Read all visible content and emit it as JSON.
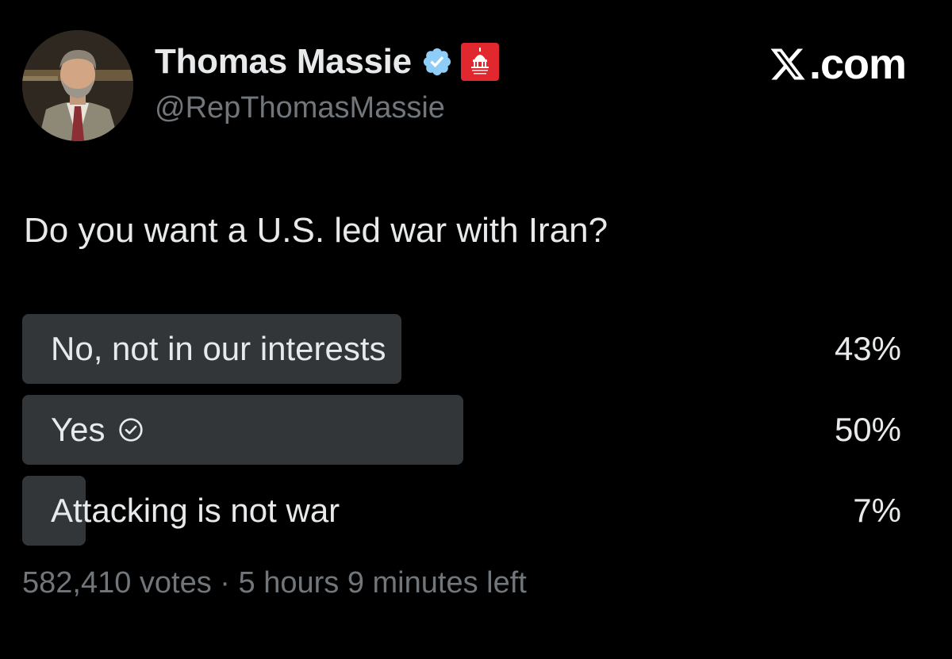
{
  "author": {
    "display_name": "Thomas Massie",
    "handle": "@RepThomasMassie",
    "verified": true,
    "affiliation_badge": "house-gop-capitol-icon"
  },
  "site_brand": ".com",
  "post": {
    "text": "Do you want a U.S. led war with Iran?"
  },
  "poll": {
    "options": [
      {
        "label": "No, not in our interests",
        "percent_label": "43%",
        "percent": 43,
        "selected": false
      },
      {
        "label": "Yes",
        "percent_label": "50%",
        "percent": 50,
        "selected": true
      },
      {
        "label": "Attacking is not war",
        "percent_label": "7%",
        "percent": 7,
        "selected": false
      }
    ],
    "votes": "582,410 votes",
    "separator": " · ",
    "time_left": "5 hours 9 minutes left"
  },
  "colors": {
    "background": "#000000",
    "text_primary": "#e7e9ea",
    "text_secondary": "#71767b",
    "poll_bar": "#333639",
    "verified_blue": "#1d9bf0",
    "badge_red": "#e0282e"
  }
}
